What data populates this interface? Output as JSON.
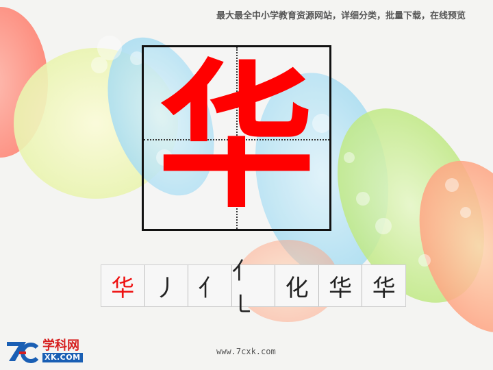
{
  "header": {
    "banner_text": "最大最全中小学教育资源网站，详细分类，批量下载，在线预览"
  },
  "main": {
    "character": "华",
    "character_color": "#ff0000"
  },
  "stroke_order": {
    "cells": [
      "华",
      "丿",
      "亻",
      "亻㇄",
      "化",
      "华",
      "华"
    ]
  },
  "logo": {
    "mark_text": "7c",
    "cn_text": "学科网",
    "en_text": "XK.COM",
    "brand_color": "#1a5fb4",
    "accent_color": "#d61f1f"
  },
  "footer": {
    "url_text": "www.7cxk.com"
  }
}
